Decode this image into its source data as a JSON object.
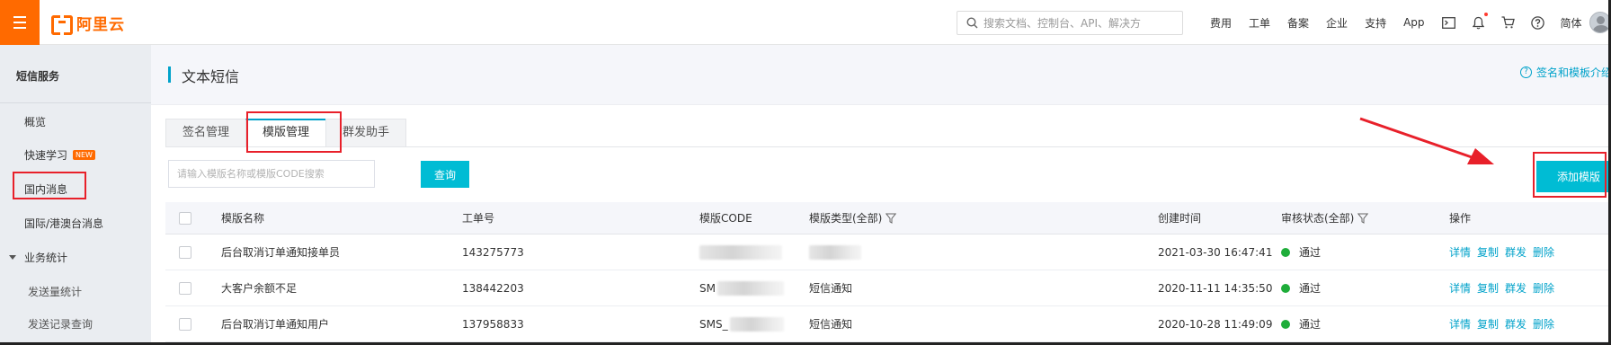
{
  "topbar": {
    "logo_text": "阿里云",
    "search_placeholder": "搜索文档、控制台、API、解决方",
    "nav": [
      "费用",
      "工单",
      "备案",
      "企业",
      "支持",
      "App"
    ],
    "lang": "简体",
    "icons": [
      "terminal-icon",
      "bell-icon",
      "cart-icon",
      "help-icon"
    ]
  },
  "sidebar": {
    "title": "短信服务",
    "items": [
      {
        "label": "概览"
      },
      {
        "label": "快速学习",
        "badge": "NEW"
      },
      {
        "label": "国内消息"
      },
      {
        "label": "国际/港澳台消息"
      },
      {
        "label": "业务统计",
        "expanded": true
      },
      {
        "label": "发送量统计"
      },
      {
        "label": "发送记录查询"
      }
    ]
  },
  "page": {
    "title": "文本短信",
    "help_link": "签名和模板介绍"
  },
  "tabs": [
    {
      "label": "签名管理",
      "active": false
    },
    {
      "label": "模版管理",
      "active": true
    },
    {
      "label": "群发助手",
      "active": false
    }
  ],
  "filter": {
    "placeholder": "请输入模版名称或模版CODE搜索",
    "query_label": "查询",
    "add_label": "添加模版"
  },
  "table": {
    "headers": [
      "模版名称",
      "工单号",
      "模版CODE",
      "模版类型(全部)",
      "创建时间",
      "审核状态(全部)",
      "操作"
    ],
    "rows": [
      {
        "name": "后台取消订单通知接单员",
        "ticket": "143275773",
        "code": "",
        "type": "",
        "created": "2021-03-30 16:47:41",
        "status": "通过"
      },
      {
        "name": "大客户余额不足",
        "ticket": "138442203",
        "code": "SM",
        "type": "短信通知",
        "created": "2020-11-11 14:35:50",
        "status": "通过"
      },
      {
        "name": "后台取消订单通知用户",
        "ticket": "137958833",
        "code": "SMS_",
        "type": "短信通知",
        "created": "2020-10-28 11:49:09",
        "status": "通过"
      }
    ],
    "actions": [
      "详情",
      "复制",
      "群发",
      "删除"
    ]
  },
  "colors": {
    "brand": "#ff6a00",
    "accent": "#00a2ca",
    "button": "#00bcd4",
    "success": "#1fad3a",
    "annotation": "#e8202a"
  }
}
